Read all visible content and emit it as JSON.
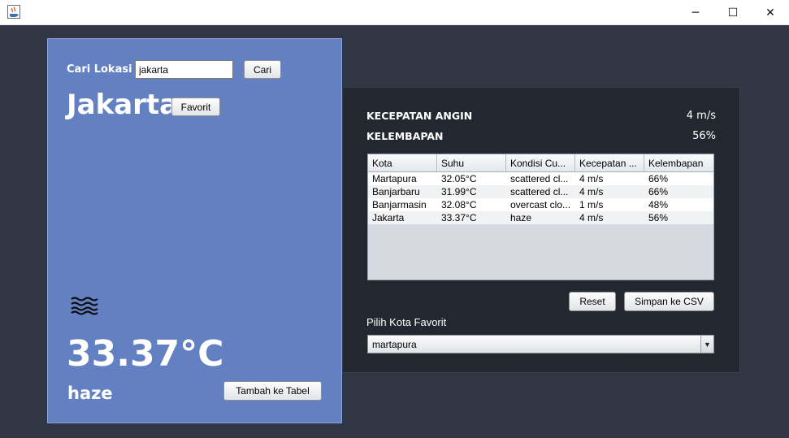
{
  "window": {
    "minimize": "─",
    "maximize": "☐",
    "close": "✕"
  },
  "search": {
    "label": "Cari Lokasi",
    "value": "jakarta",
    "button": "Cari"
  },
  "city": {
    "name": "Jakarta",
    "favorite_button": "Favorit"
  },
  "weather": {
    "icon": "haze-icon",
    "temperature": "33.37°C",
    "condition": "haze",
    "add_button": "Tambah ke Tabel"
  },
  "stats": {
    "wind_label": "KECEPATAN ANGIN",
    "wind_value": "4 m/s",
    "humidity_label": "KELEMBAPAN",
    "humidity_value": "56%"
  },
  "table": {
    "headers": [
      "Kota",
      "Suhu",
      "Kondisi Cu...",
      "Kecepatan ...",
      "Kelembapan"
    ],
    "rows": [
      [
        "Martapura",
        "32.05°C",
        "scattered cl...",
        "4 m/s",
        "66%"
      ],
      [
        "Banjarbaru",
        "31.99°C",
        "scattered cl...",
        "4 m/s",
        "66%"
      ],
      [
        "Banjarmasin",
        "32.08°C",
        "overcast clo...",
        "1 m/s",
        "48%"
      ],
      [
        "Jakarta",
        "33.37°C",
        "haze",
        "4 m/s",
        "56%"
      ]
    ]
  },
  "actions": {
    "reset": "Reset",
    "save_csv": "Simpan ke CSV"
  },
  "favorites": {
    "label": "Pilih Kota Favorit",
    "selected": "martapura",
    "arrow": "▼"
  },
  "colors": {
    "left_panel": "#6380c2",
    "right_panel": "#23272f",
    "background": "#313644"
  }
}
